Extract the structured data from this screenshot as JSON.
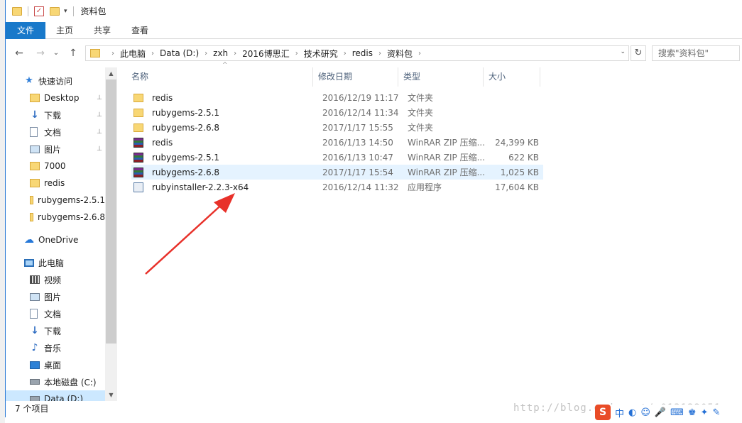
{
  "window": {
    "title": "资料包",
    "qa_dropdown_glyph": "▾"
  },
  "ribbon": {
    "file": "文件",
    "home": "主页",
    "share": "共享",
    "view": "查看"
  },
  "address": {
    "crumbs": [
      "此电脑",
      "Data (D:)",
      "zxh",
      "2016博思汇",
      "技术研究",
      "redis",
      "资料包"
    ],
    "separator": "›",
    "dropdown_glyph": "⌄",
    "refresh_glyph": "↻"
  },
  "nav_buttons": {
    "back": "←",
    "forward": "→",
    "recent": "⌄",
    "up": "↑"
  },
  "search": {
    "placeholder": "搜索\"资料包\""
  },
  "sidebar": {
    "quick_access": "快速访问",
    "items": [
      {
        "label": "Desktop",
        "pinned": true
      },
      {
        "label": "下载",
        "pinned": true
      },
      {
        "label": "文档",
        "pinned": true
      },
      {
        "label": "图片",
        "pinned": true
      },
      {
        "label": "7000",
        "pinned": false
      },
      {
        "label": "redis",
        "pinned": false
      },
      {
        "label": "rubygems-2.5.1",
        "pinned": false
      },
      {
        "label": "rubygems-2.6.8",
        "pinned": false
      }
    ],
    "onedrive": "OneDrive",
    "this_pc": "此电脑",
    "pc_items": [
      {
        "label": "视频"
      },
      {
        "label": "图片"
      },
      {
        "label": "文档"
      },
      {
        "label": "下载"
      },
      {
        "label": "音乐"
      },
      {
        "label": "桌面"
      },
      {
        "label": "本地磁盘 (C:)"
      },
      {
        "label": "Data (D:)"
      }
    ],
    "pin_glyph": "📌",
    "scroll_up_glyph": "▲",
    "scroll_down_glyph": "▼"
  },
  "columns": {
    "name": "名称",
    "date": "修改日期",
    "type": "类型",
    "size": "大小",
    "sort_glyph": "^"
  },
  "files": [
    {
      "name": "redis",
      "date": "2016/12/19 11:17",
      "type": "文件夹",
      "size": "",
      "icon": "folder-icon"
    },
    {
      "name": "rubygems-2.5.1",
      "date": "2016/12/14 11:34",
      "type": "文件夹",
      "size": "",
      "icon": "folder-icon"
    },
    {
      "name": "rubygems-2.6.8",
      "date": "2017/1/17 15:55",
      "type": "文件夹",
      "size": "",
      "icon": "folder-icon"
    },
    {
      "name": "redis",
      "date": "2016/1/13 14:50",
      "type": "WinRAR ZIP 压缩...",
      "size": "24,399 KB",
      "icon": "winrar-icon"
    },
    {
      "name": "rubygems-2.5.1",
      "date": "2016/1/13 10:47",
      "type": "WinRAR ZIP 压缩...",
      "size": "622 KB",
      "icon": "winrar-icon"
    },
    {
      "name": "rubygems-2.6.8",
      "date": "2017/1/17 15:54",
      "type": "WinRAR ZIP 压缩...",
      "size": "1,025 KB",
      "icon": "winrar-icon"
    },
    {
      "name": "rubyinstaller-2.2.3-x64",
      "date": "2016/12/14 11:32",
      "type": "应用程序",
      "size": "17,604 KB",
      "icon": "installer-icon"
    }
  ],
  "status": {
    "count": "7 个项目"
  },
  "watermark": "http://blog.csdn.net/u013132051",
  "ime": {
    "logo": "S",
    "lang": "中"
  },
  "colors": {
    "accent": "#1979ca",
    "hover_row": "#e5f3ff",
    "annotation_arrow": "#e8312a"
  }
}
